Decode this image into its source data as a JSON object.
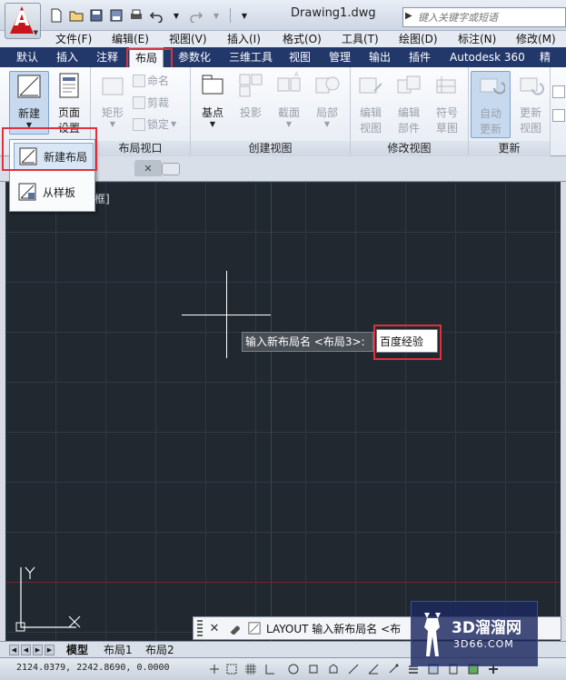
{
  "titlebar": {
    "doc_title": "Drawing1.dwg",
    "search_placeholder": "键入关键字或短语",
    "app_logo": "A"
  },
  "menubar": {
    "items": [
      "文件(F)",
      "编辑(E)",
      "视图(V)",
      "插入(I)",
      "格式(O)",
      "工具(T)",
      "绘图(D)",
      "标注(N)",
      "修改(M)"
    ]
  },
  "ribbon_tabs": {
    "items": [
      "默认",
      "插入",
      "注释",
      "布局",
      "参数化",
      "三维工具",
      "视图",
      "管理",
      "输出",
      "插件",
      "Autodesk 360",
      "精选"
    ],
    "active": "布局"
  },
  "ribbon": {
    "layout_group": {
      "new_label": "新建",
      "page_setup_label_1": "页面",
      "page_setup_label_2": "设置"
    },
    "viewport_group": {
      "label": "布局视口",
      "rect_label": "矩形",
      "name_label": "命名",
      "clip_label": "剪裁",
      "lock_label": "锁定"
    },
    "create_view_group": {
      "label": "创建视图",
      "base_label": "基点",
      "projected_label": "投影",
      "section_label": "截面",
      "detail_label": "局部"
    },
    "modify_view_group": {
      "label": "修改视图",
      "edit_view_1": "编辑",
      "edit_view_2": "视图",
      "edit_comp_1": "编辑",
      "edit_comp_2": "部件",
      "symbol_1": "符号",
      "symbol_2": "草图"
    },
    "update_group": {
      "label": "更新",
      "auto_1": "自动",
      "auto_2": "更新",
      "update_1": "更新",
      "update_2": "视图"
    }
  },
  "dropdown": {
    "items": [
      "新建布局",
      "从样板"
    ]
  },
  "canvas": {
    "viewport_label": "框]",
    "prompt_text": "输入新布局名 <布局3>:",
    "input_value": "百度经验"
  },
  "cmdline": {
    "text": "LAYOUT 输入新布局名 <布"
  },
  "watermark": {
    "brand": "3D溜溜网",
    "site": "3D66.COM"
  },
  "layout_tabs": {
    "items": [
      "模型",
      "布局1",
      "布局2"
    ]
  },
  "status": {
    "coords": "2124.0379, 2242.8690, 0.0000"
  },
  "colors": {
    "accent_red": "#e0313a",
    "tab_strip": "#22386b",
    "canvas_bg": "#212830"
  }
}
